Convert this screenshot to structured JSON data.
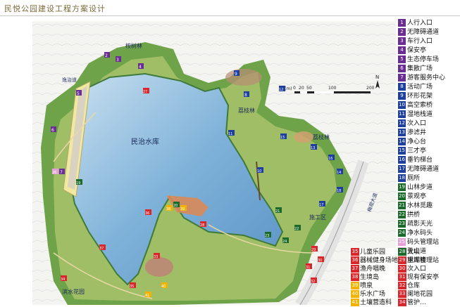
{
  "header": {
    "title": "民悦公园建设工程方案设计"
  },
  "map": {
    "lake_name": "民治水库",
    "labels": {
      "grove1": "桉树林",
      "grove2": "荔枝林",
      "grove3": "荔枝林",
      "road1": "逸治道",
      "road2": "梅观大道",
      "construction": "施工区",
      "garden": "滨水花园"
    },
    "scale": {
      "unit": "(m)",
      "ticks": [
        "0",
        "20",
        "50",
        "100",
        "200"
      ]
    },
    "north": "N",
    "markers": [
      "2",
      "3",
      "4",
      "5",
      "6",
      "7",
      "8",
      "9",
      "10",
      "11",
      "12",
      "13",
      "14",
      "15",
      "16",
      "17",
      "18",
      "19",
      "20",
      "21",
      "22",
      "23",
      "24",
      "26",
      "27",
      "28",
      "29",
      "30",
      "31",
      "32",
      "33",
      "34",
      "35",
      "36",
      "37",
      "38",
      "39",
      "40",
      "41"
    ]
  },
  "legend": {
    "items": [
      {
        "num": "1",
        "label": "人行入口",
        "color": "#6a2d91"
      },
      {
        "num": "2",
        "label": "无障碍通道",
        "color": "#6a2d91"
      },
      {
        "num": "3",
        "label": "车行入口",
        "color": "#6a2d91"
      },
      {
        "num": "4",
        "label": "保安亭",
        "color": "#6a2d91"
      },
      {
        "num": "5",
        "label": "生态停车场",
        "color": "#6a2d91"
      },
      {
        "num": "6",
        "label": "集散广场",
        "color": "#6a2d91"
      },
      {
        "num": "7",
        "label": "游客服务中心",
        "color": "#6a2d91"
      },
      {
        "num": "8",
        "label": "活动广场",
        "color": "#1f3f9e"
      },
      {
        "num": "9",
        "label": "环形花架",
        "color": "#1f3f9e"
      },
      {
        "num": "10",
        "label": "高空索桥",
        "color": "#1f3f9e"
      },
      {
        "num": "11",
        "label": "湿地栈道",
        "color": "#1f3f9e"
      },
      {
        "num": "12",
        "label": "次入口",
        "color": "#1f3f9e"
      },
      {
        "num": "13",
        "label": "渗滤井",
        "color": "#1f3f9e"
      },
      {
        "num": "14",
        "label": "净心台",
        "color": "#1f3f9e"
      },
      {
        "num": "15",
        "label": "三才亭",
        "color": "#1f3f9e"
      },
      {
        "num": "16",
        "label": "垂钓梯台",
        "color": "#1f3f9e"
      },
      {
        "num": "17",
        "label": "无障碍通道",
        "color": "#1f3f9e"
      },
      {
        "num": "18",
        "label": "厕所",
        "color": "#1f3f9e"
      },
      {
        "num": "19",
        "label": "山林步道",
        "color": "#1b6a2a"
      },
      {
        "num": "20",
        "label": "景观亭",
        "color": "#1b6a2a"
      },
      {
        "num": "21",
        "label": "水林觅趣",
        "color": "#1b6a2a"
      },
      {
        "num": "22",
        "label": "拱桥",
        "color": "#1b6a2a"
      },
      {
        "num": "23",
        "label": "疏影天光",
        "color": "#1b6a2a"
      },
      {
        "num": "24",
        "label": "净水码头",
        "color": "#1b6a2a"
      },
      {
        "num": "25",
        "label": "码头管理站",
        "color": "#e6a0d8"
      },
      {
        "num": "26",
        "label": "登山道",
        "color": "#e6a0d8"
      },
      {
        "num": "27",
        "label": "望湖楼",
        "color": "#e6a0d8"
      }
    ],
    "bottom_left": [
      {
        "num": "35",
        "label": "儿童乐园",
        "color": "#d8262b"
      },
      {
        "num": "36",
        "label": "器械健身场地",
        "color": "#d8262b"
      },
      {
        "num": "37",
        "label": "渔舟唱晚",
        "color": "#d8262b"
      },
      {
        "num": "38",
        "label": "生境岛",
        "color": "#d8262b"
      },
      {
        "num": "39",
        "label": "喷泉",
        "color": "#f2b300"
      },
      {
        "num": "40",
        "label": "乐水广场",
        "color": "#f2b300"
      },
      {
        "num": "41",
        "label": "土壤营造科",
        "color": "#f2b300"
      }
    ],
    "bottom_right": [
      {
        "num": "28",
        "label": "大坝",
        "color": "#1b6a2a"
      },
      {
        "num": "29",
        "label": "水库管理站",
        "color": "#d8262b"
      },
      {
        "num": "30",
        "label": "次入口",
        "color": "#d8262b"
      },
      {
        "num": "31",
        "label": "现有保安亭",
        "color": "#d8262b"
      },
      {
        "num": "32",
        "label": "仓库",
        "color": "#d8262b"
      },
      {
        "num": "33",
        "label": "阑地花园",
        "color": "#d8262b"
      },
      {
        "num": "34",
        "label": "管护…",
        "color": "#d8262b"
      }
    ]
  }
}
